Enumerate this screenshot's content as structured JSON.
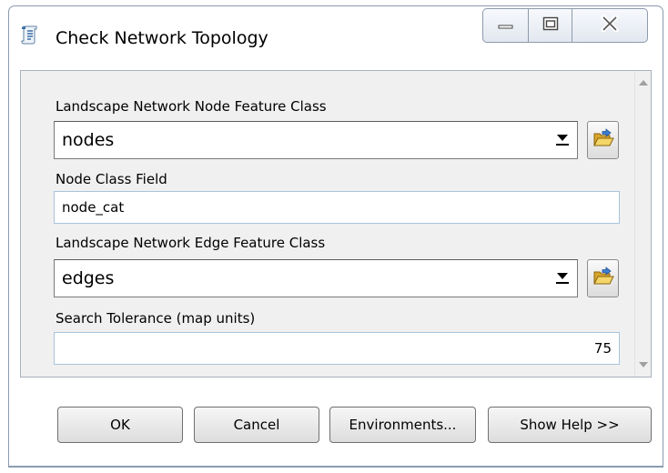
{
  "window": {
    "title": "Check Network Topology",
    "app_icon": "script-tool-icon"
  },
  "form": {
    "node_fc": {
      "label": "Landscape Network Node Feature Class",
      "value": "nodes"
    },
    "node_field": {
      "label": "Node Class Field",
      "value": "node_cat"
    },
    "edge_fc": {
      "label": "Landscape Network Edge Feature Class",
      "value": "edges"
    },
    "tolerance": {
      "label": "Search Tolerance (map units)",
      "value": "75"
    }
  },
  "buttons": {
    "ok": "OK",
    "cancel": "Cancel",
    "environments": "Environments...",
    "help": "Show Help >>"
  },
  "icons": {
    "browse": "open-folder-icon",
    "minimize": "minimize-icon",
    "maximize": "maximize-icon",
    "close": "close-icon"
  },
  "colors": {
    "panel_bg": "#f0f0f0",
    "folder": "#e8c040",
    "textbox_border": "#a8c4de"
  }
}
